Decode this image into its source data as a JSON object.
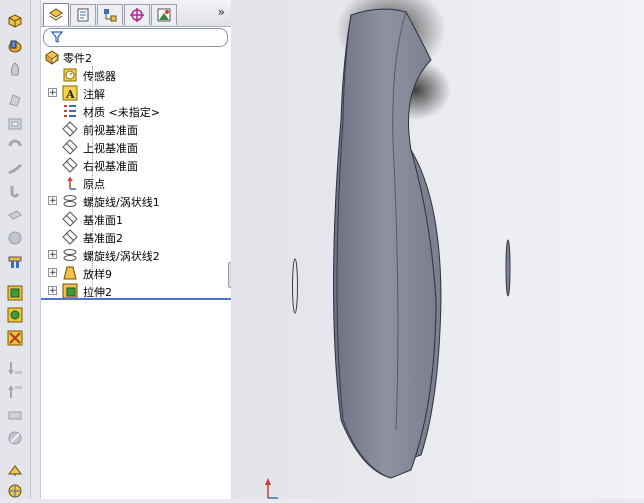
{
  "feature_manager": {
    "tabs": [
      {
        "name": "featuremanager-tab",
        "icon": "feature-tree-icon",
        "active": true
      },
      {
        "name": "propertymanager-tab",
        "icon": "property-icon",
        "active": false
      },
      {
        "name": "configurationmanager-tab",
        "icon": "configuration-icon",
        "active": false
      },
      {
        "name": "dimxpert-tab",
        "icon": "crosshair-icon",
        "active": false
      },
      {
        "name": "display-manager-tab",
        "icon": "display-icon",
        "active": false
      }
    ],
    "more_label": "»",
    "filter_icon": "filter-icon",
    "tree": [
      {
        "label": "零件2",
        "icon": "part-icon",
        "expandable": false,
        "level": 0
      },
      {
        "label": "传感器",
        "icon": "sensor-icon",
        "expandable": false,
        "level": 1
      },
      {
        "label": "注解",
        "icon": "annotation-icon",
        "expandable": true,
        "level": 1
      },
      {
        "label": "材质 <未指定>",
        "icon": "material-icon",
        "expandable": false,
        "level": 1
      },
      {
        "label": "前视基准面",
        "icon": "plane-icon",
        "expandable": false,
        "level": 1
      },
      {
        "label": "上视基准面",
        "icon": "plane-icon",
        "expandable": false,
        "level": 1
      },
      {
        "label": "右视基准面",
        "icon": "plane-icon",
        "expandable": false,
        "level": 1
      },
      {
        "label": "原点",
        "icon": "origin-icon",
        "expandable": false,
        "level": 1
      },
      {
        "label": "螺旋线/涡状线1",
        "icon": "helix-icon",
        "expandable": true,
        "level": 1
      },
      {
        "label": "基准面1",
        "icon": "plane-icon",
        "expandable": false,
        "level": 1
      },
      {
        "label": "基准面2",
        "icon": "plane-icon",
        "expandable": false,
        "level": 1
      },
      {
        "label": "螺旋线/涡状线2",
        "icon": "helix-icon",
        "expandable": true,
        "level": 1
      },
      {
        "label": "放样9",
        "icon": "loft-icon",
        "expandable": true,
        "level": 1
      },
      {
        "label": "拉伸2",
        "icon": "extrude-icon",
        "expandable": true,
        "level": 1
      }
    ]
  },
  "left_toolbar": [
    "extruded-boss-icon",
    "revolved-boss-icon",
    "swept-boss-icon",
    "lofted-boss-icon",
    "extruded-cut-icon",
    "revolved-cut-icon",
    "swept-cut-icon",
    "lofted-cut-icon",
    "fillet-icon",
    "rib-icon",
    "linear-pattern-icon",
    "mirror-icon",
    "shell-icon",
    "draft-icon",
    "intersect-icon",
    "wrap-icon",
    "dome-icon",
    "reference-geometry-icon",
    "curves-icon"
  ],
  "colors": {
    "accent": "#4f76c8",
    "part_gray": "#8c8f9c",
    "viewport_bg": "#ecedf1"
  }
}
